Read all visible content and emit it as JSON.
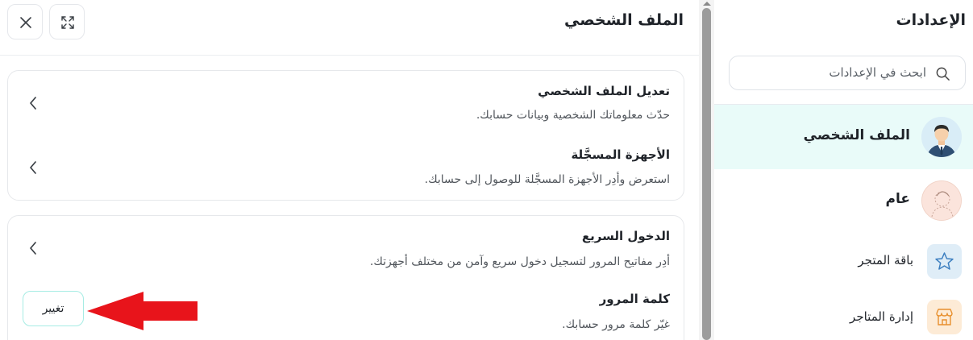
{
  "sidebar": {
    "title": "الإعدادات",
    "search_placeholder": "ابحث في الإعدادات",
    "items": [
      {
        "label": "الملف الشخصي",
        "icon": "user-avatar",
        "active": true
      },
      {
        "label": "عام",
        "icon": "general-avatar"
      },
      {
        "label": "باقة المتجر",
        "icon": "star-icon"
      },
      {
        "label": "إدارة المتاجر",
        "icon": "store-icon"
      }
    ]
  },
  "panel": {
    "title": "الملف الشخصي",
    "close_icon": "close-icon",
    "expand_icon": "expand-icon",
    "sections": [
      {
        "title": "تعديل الملف الشخصي",
        "description": "حدّث معلوماتك الشخصية وبيانات حسابك."
      },
      {
        "title": "الأجهزة المسجَّلة",
        "description": "استعرض وأدِر الأجهزة المسجَّلة للوصول إلى حسابك."
      },
      {
        "title": "الدخول السريع",
        "description": "أدِر مفاتيح المرور لتسجيل دخول سريع وآمن من مختلف أجهزتك."
      },
      {
        "title": "كلمة المرور",
        "description": "غيّر كلمة مرور حسابك.",
        "button": "تغيير"
      }
    ]
  },
  "colors": {
    "active_bg": "#e9fbf9",
    "button_border": "#a6ece4",
    "annotation_arrow": "#e8141b"
  }
}
